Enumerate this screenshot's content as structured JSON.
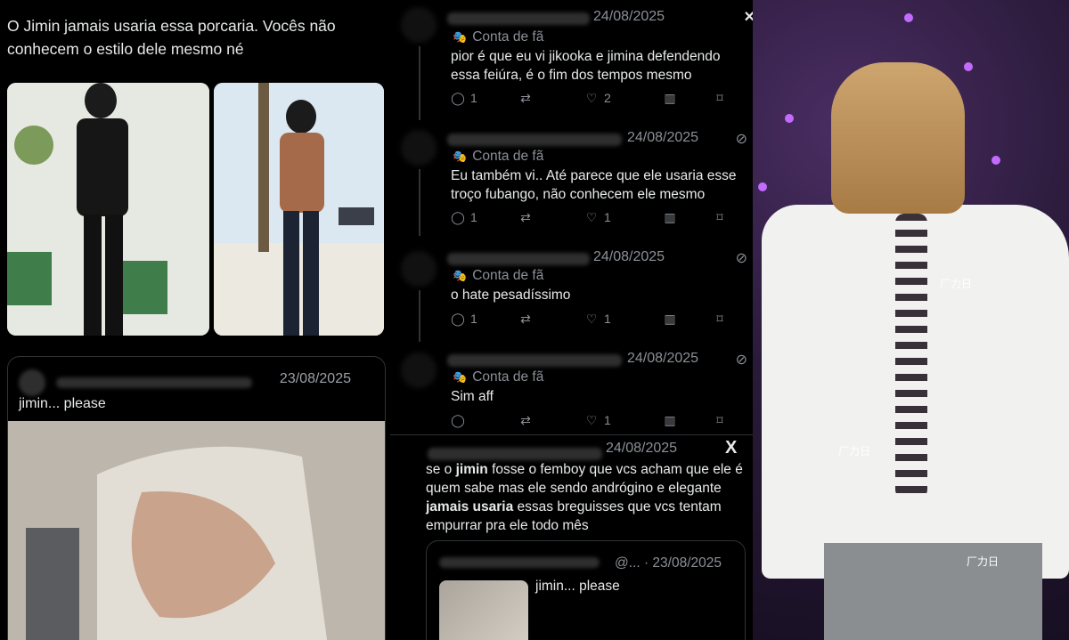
{
  "left": {
    "post_text": "O Jimin jamais usaria essa porcaria. Vocês não conhecem o estilo dele mesmo né",
    "quote": {
      "date": "23/08/2025",
      "text": "jimin... please"
    }
  },
  "mid": {
    "tweets": [
      {
        "date": "24/08/2025",
        "fan_label": "Conta de fã",
        "text": "pior é que eu vi jikooka e jimina defendendo essa feiúra, é o fim dos tempos mesmo",
        "replies": "1",
        "likes": "2"
      },
      {
        "date": "24/08/2025",
        "fan_label": "Conta de fã",
        "text": "Eu também vi.. Até parece que ele usaria esse troço fubango, não conhecem ele mesmo",
        "replies": "1",
        "likes": "1"
      },
      {
        "date": "24/08/2025",
        "fan_label": "Conta de fã",
        "text": "o hate pesadíssimo",
        "replies": "1",
        "likes": "1"
      },
      {
        "date": "24/08/2025",
        "fan_label": "Conta de fã",
        "text": "Sim aff",
        "replies": "",
        "likes": "1"
      }
    ],
    "main_tweet": {
      "date": "24/08/2025",
      "text_1": "se o ",
      "bold_1": "jimin",
      "text_2": " fosse o femboy que vcs acham que ele é quem sabe mas ele sendo andrógino e elegante ",
      "bold_2": "jamais usaria",
      "text_3": " essas breguisses que vcs tentam empurrar pra ele todo mês",
      "embed_handle": "@...",
      "embed_date": "23/08/2025",
      "embed_text": "jimin... please"
    },
    "x_logo": "X"
  },
  "right": {
    "watermarks": [
      "厂力日",
      "厂力日",
      "厂力日"
    ]
  },
  "icons": {
    "reply": "reply-icon",
    "retweet": "retweet-icon",
    "like": "heart-icon",
    "views": "views-icon",
    "bookmark": "bookmark-icon",
    "share": "share-icon",
    "mask": "mask-icon",
    "grok": "grok-icon"
  }
}
